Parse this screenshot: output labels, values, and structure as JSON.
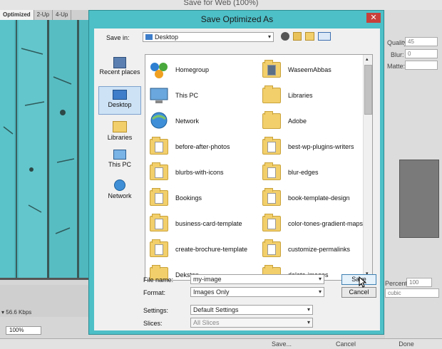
{
  "window": {
    "title": "Save for Web (100%)"
  },
  "tabs": [
    "Optimized",
    "2-Up",
    "4-Up"
  ],
  "status": {
    "speed": "56.6 Kbps",
    "zoom": "100%"
  },
  "right_panel": {
    "quality_label": "Quality:",
    "quality_value": "45",
    "blur_label": "Blur:",
    "blur_value": "0",
    "matte_label": "Matte:",
    "percent_label": "Percent:",
    "percent_value": "100",
    "resample_value": "cubic"
  },
  "bottom_buttons": {
    "save": "Save...",
    "cancel": "Cancel",
    "done": "Done"
  },
  "dialog": {
    "title": "Save Optimized As",
    "close": "✕",
    "save_in_label": "Save in:",
    "save_in_value": "Desktop",
    "places": [
      "Recent places",
      "Desktop",
      "Libraries",
      "This PC",
      "Network"
    ],
    "items_left": [
      "Homegroup",
      "This PC",
      "Network",
      "before-after-photos",
      "blurbs-with-icons",
      "Bookings",
      "business-card-template",
      "create-brochure-template",
      "Dekstop"
    ],
    "items_right": [
      "WaseemAbbas",
      "Libraries",
      "Adobe",
      "best-wp-plugins-writers",
      "blur-edges",
      "book-template-design",
      "color-tones-gradient-maps",
      "customize-permalinks",
      "delete-images"
    ],
    "file_name_label": "File name:",
    "file_name_value": "my-image",
    "format_label": "Format:",
    "format_value": "Images Only",
    "settings_label": "Settings:",
    "settings_value": "Default Settings",
    "slices_label": "Slices:",
    "slices_value": "All Slices",
    "save_button": "Save",
    "cancel_button": "Cancel"
  }
}
